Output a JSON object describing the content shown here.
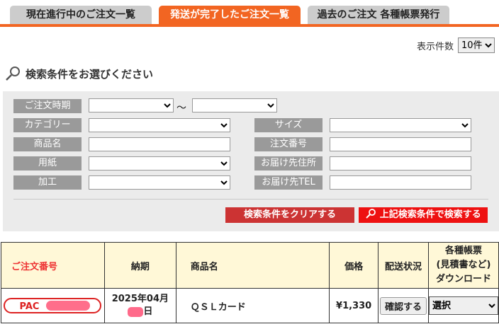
{
  "tabs": [
    {
      "label": "現在進行中のご注文一覧",
      "active": false
    },
    {
      "label": "発送が完了したご注文一覧",
      "active": true
    },
    {
      "label": "過去のご注文 各種帳票発行",
      "active": false
    }
  ],
  "per_page": {
    "label": "表示件数",
    "value": "10件"
  },
  "search": {
    "title": "検索条件をお選びください",
    "order_period_label": "ご注文時期",
    "range_sep": "～",
    "category_label": "カテゴリー",
    "size_label": "サイズ",
    "product_label": "商品名",
    "order_no_label": "注文番号",
    "paper_label": "用紙",
    "address_label": "お届け先住所",
    "process_label": "加工",
    "tel_label": "お届け先TEL",
    "clear_button": "検索条件をクリアする",
    "search_button": "上記検索条件で検索する"
  },
  "table": {
    "headers": {
      "order_no": "ご注文番号",
      "delivery": "納期",
      "product": "商品名",
      "price": "価格",
      "status": "配送状況",
      "docs": "各種帳票 (見積書など) ダウンロード"
    },
    "docs_header_lines": [
      "各種帳票",
      "(見積書など)",
      "ダウンロード"
    ],
    "rows": [
      {
        "order_no": "PAC",
        "delivery_line1": "2025年04月",
        "delivery_line2": "日",
        "product": "ＱＳＬカード",
        "price": "¥1,330",
        "status_button": "確認する",
        "docs_select": "選択"
      }
    ]
  },
  "colors": {
    "accent": "#f26522",
    "label_bg": "#9a9a9a",
    "header_bg": "#fff8d7",
    "search_bg": "#ebebeb"
  }
}
